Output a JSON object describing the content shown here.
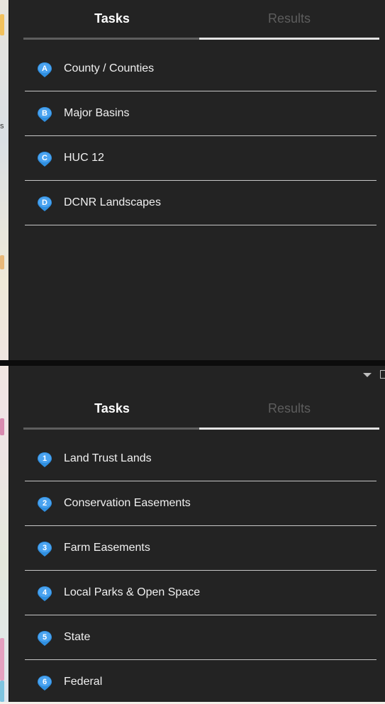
{
  "map_edge": {
    "labels": [
      "s"
    ]
  },
  "top_panel": {
    "tabs": [
      {
        "label": "Tasks",
        "active": true
      },
      {
        "label": "Results",
        "active": false
      }
    ],
    "items": [
      {
        "marker": "A",
        "label": "County / Counties"
      },
      {
        "marker": "B",
        "label": "Major Basins"
      },
      {
        "marker": "C",
        "label": "HUC 12"
      },
      {
        "marker": "D",
        "label": "DCNR Landscapes"
      }
    ]
  },
  "bottom_panel": {
    "window_controls": {
      "collapse_icon": "caret-down-icon",
      "maximize_icon": "maximize-icon"
    },
    "tabs": [
      {
        "label": "Tasks",
        "active": true
      },
      {
        "label": "Results",
        "active": false
      }
    ],
    "items": [
      {
        "marker": "1",
        "label": "Land Trust Lands"
      },
      {
        "marker": "2",
        "label": "Conservation Easements"
      },
      {
        "marker": "3",
        "label": "Farm Easements"
      },
      {
        "marker": "4",
        "label": "Local Parks & Open Space"
      },
      {
        "marker": "5",
        "label": "State"
      },
      {
        "marker": "6",
        "label": "Federal"
      }
    ]
  },
  "colors": {
    "panel_bg": "#232323",
    "pin_blue": "#2f8fe0",
    "pin_dark": "#1a5ea8"
  }
}
